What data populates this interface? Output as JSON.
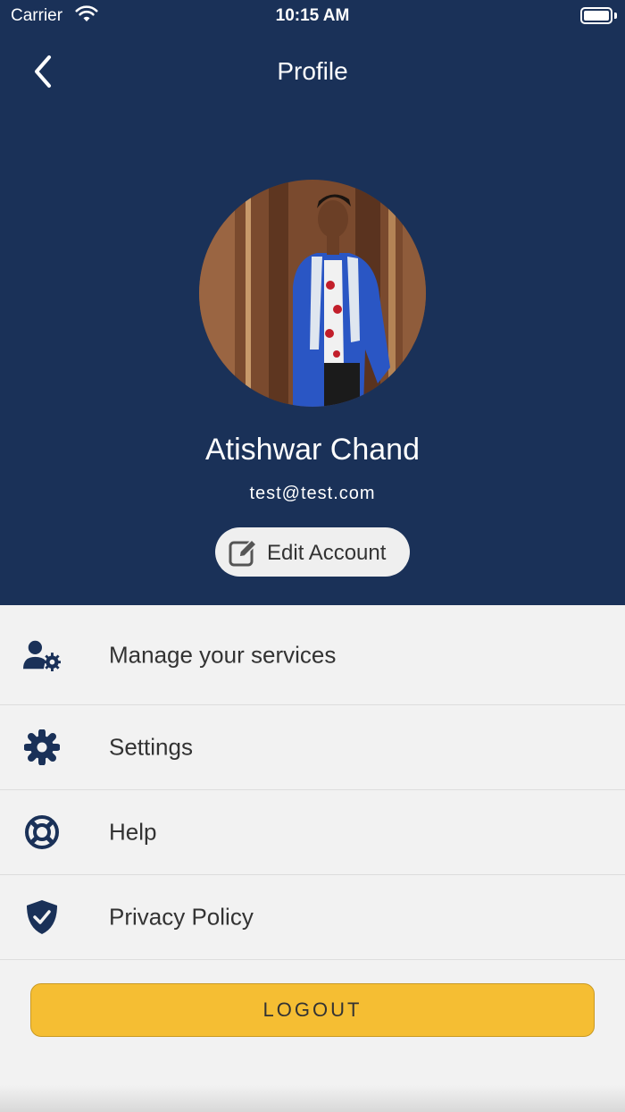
{
  "status_bar": {
    "carrier": "Carrier",
    "time": "10:15 AM"
  },
  "nav": {
    "title": "Profile",
    "back_icon": "chevron-left-icon"
  },
  "profile": {
    "name": "Atishwar Chand",
    "email": "test@test.com",
    "edit_label": "Edit Account",
    "edit_icon": "edit-icon"
  },
  "menu": {
    "items": [
      {
        "label": "Manage your services",
        "icon": "user-gear-icon"
      },
      {
        "label": "Settings",
        "icon": "gear-icon"
      },
      {
        "label": "Help",
        "icon": "lifebuoy-icon"
      },
      {
        "label": "Privacy Policy",
        "icon": "shield-check-icon"
      }
    ]
  },
  "logout_label": "LOGOUT",
  "colors": {
    "header_bg": "#1a3158",
    "page_bg": "#f2f2f2",
    "accent": "#f5be33",
    "icon": "#1a3158"
  }
}
